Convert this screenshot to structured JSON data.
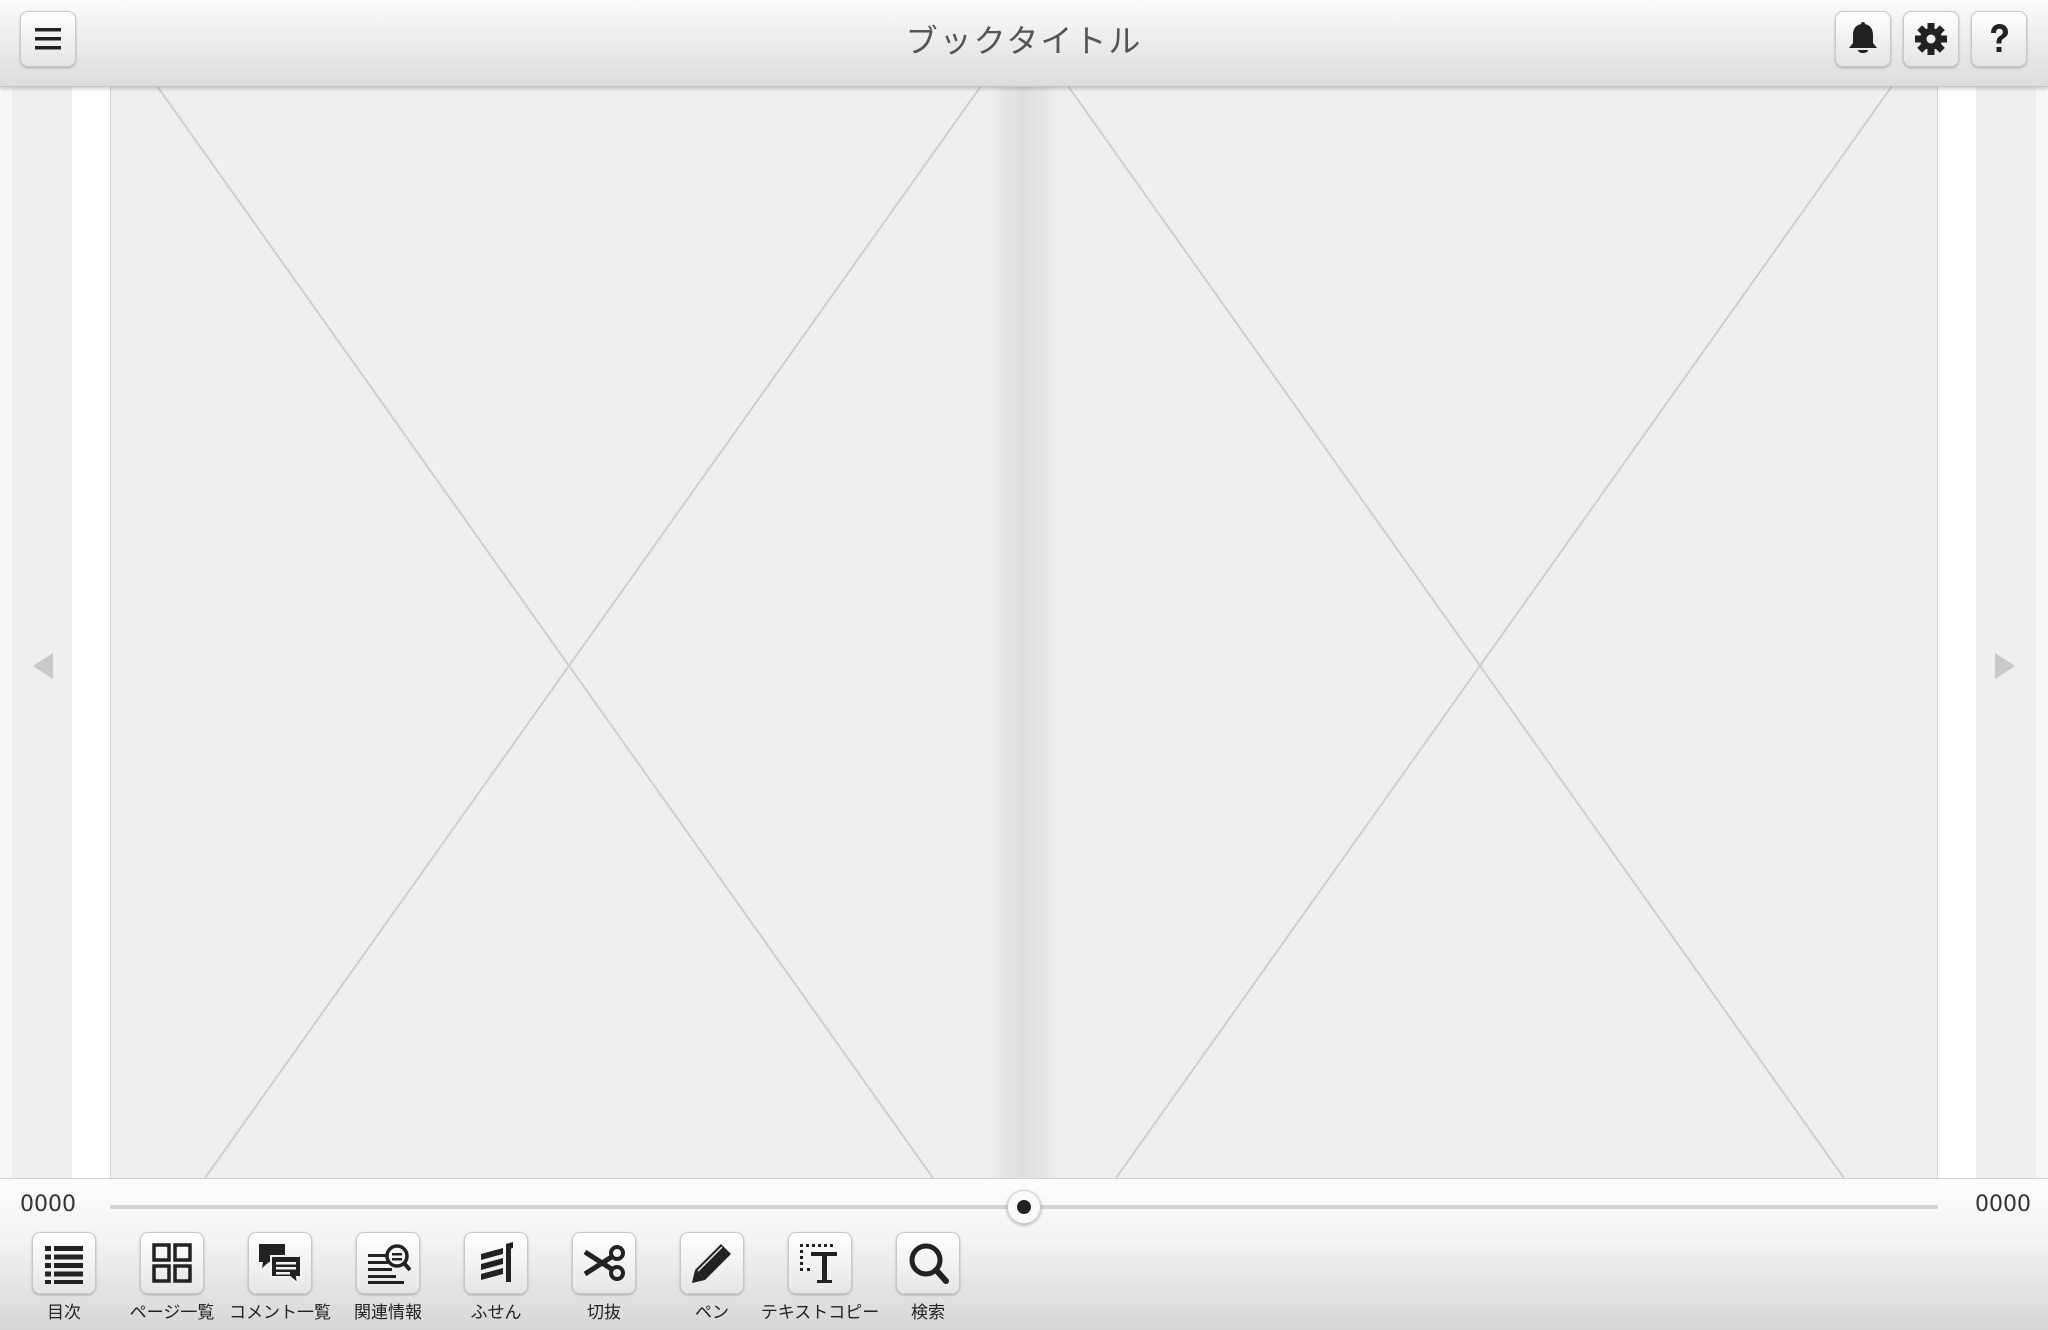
{
  "header": {
    "title": "ブックタイトル"
  },
  "icons": {
    "menu": "hamburger-menu-icon",
    "notifications": "bell-icon",
    "settings": "gear-icon",
    "help": "question-mark-icon",
    "prev": "triangle-left-icon",
    "next": "triangle-right-icon"
  },
  "pager": {
    "current_page": "0000",
    "total_pages": "0000",
    "position": 0.5
  },
  "toolbar": {
    "items": [
      {
        "label": "目次",
        "icon": "list-icon"
      },
      {
        "label": "ページ一覧",
        "icon": "grid-icon"
      },
      {
        "label": "コメント一覧",
        "icon": "comments-icon"
      },
      {
        "label": "関連情報",
        "icon": "related-info-icon"
      },
      {
        "label": "ふせん",
        "icon": "sticky-note-icon"
      },
      {
        "label": "切抜",
        "icon": "scissors-icon"
      },
      {
        "label": "ペン",
        "icon": "pencil-icon"
      },
      {
        "label": "テキストコピー",
        "icon": "text-copy-icon"
      },
      {
        "label": "検索",
        "icon": "search-icon"
      }
    ]
  },
  "colors": {
    "header_bg": "#e6e6e6",
    "page_bg": "#efefef",
    "placeholder_line": "#cccccc",
    "icon": "#222222"
  }
}
